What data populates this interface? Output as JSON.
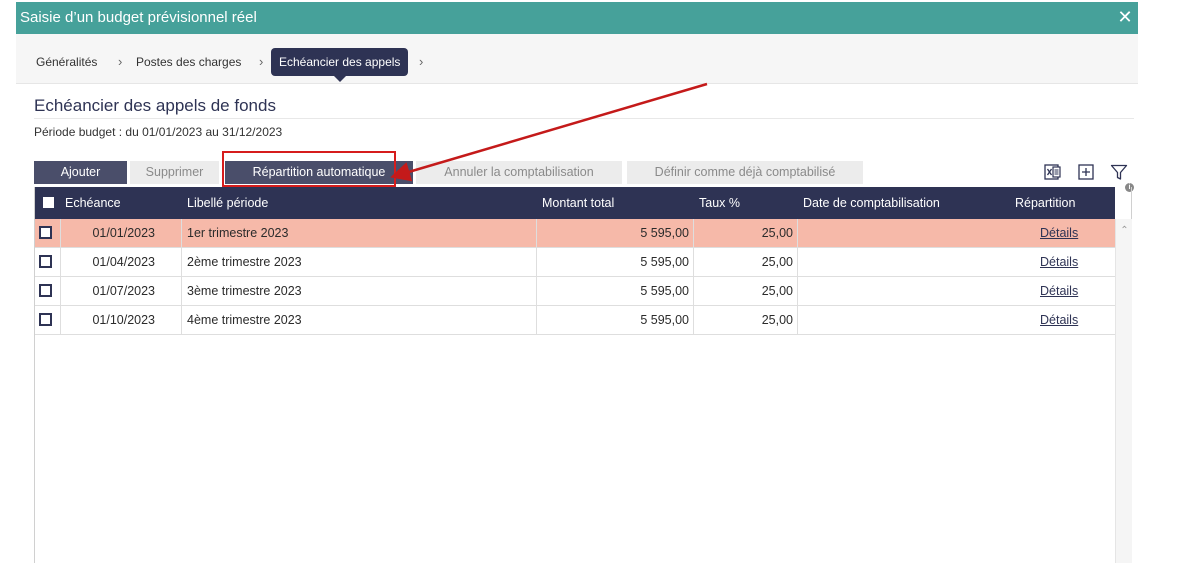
{
  "window": {
    "title": "Saisie d’un budget prévisionnel réel",
    "close_icon": "close-icon",
    "accent_color": "#46a19a"
  },
  "breadcrumb": {
    "items": [
      {
        "label": "Généralités",
        "active": false
      },
      {
        "label": "Postes des charges",
        "active": false
      },
      {
        "label": "Echéancier des appels",
        "active": true
      }
    ],
    "separator": "›",
    "active_color": "#2e3354"
  },
  "section": {
    "title": "Echéancier des appels de fonds",
    "period": "Période budget : du 01/01/2023 au 31/12/2023"
  },
  "toolbar": {
    "add_label": "Ajouter",
    "delete_label": "Supprimer",
    "auto_split_label": "Répartition automatique",
    "cancel_accounting_label": "Annuler la comptabilisation",
    "mark_accounted_label": "Définir comme déjà comptabilisé",
    "icons": [
      "excel-export-icon",
      "expand-icon",
      "filter-icon",
      "info-icon"
    ]
  },
  "grid": {
    "columns": [
      "Echéance",
      "Libellé période",
      "Montant total",
      "Taux %",
      "Date de comptabilisation",
      "Répartition"
    ],
    "rows": [
      {
        "date": "01/01/2023",
        "label": "1er trimestre 2023",
        "amount": "5 595,00",
        "rate": "25,00",
        "accounting_date": "",
        "split": "Détails",
        "selected": true
      },
      {
        "date": "01/04/2023",
        "label": "2ème trimestre 2023",
        "amount": "5 595,00",
        "rate": "25,00",
        "accounting_date": "",
        "split": "Détails",
        "selected": false
      },
      {
        "date": "01/07/2023",
        "label": "3ème trimestre 2023",
        "amount": "5 595,00",
        "rate": "25,00",
        "accounting_date": "",
        "split": "Détails",
        "selected": false
      },
      {
        "date": "01/10/2023",
        "label": "4ème trimestre 2023",
        "amount": "5 595,00",
        "rate": "25,00",
        "accounting_date": "",
        "split": "Détails",
        "selected": false
      }
    ],
    "header_color": "#2e3354",
    "selected_row_color": "#f6b9a9"
  },
  "annotation": {
    "color": "#c41a1a"
  }
}
